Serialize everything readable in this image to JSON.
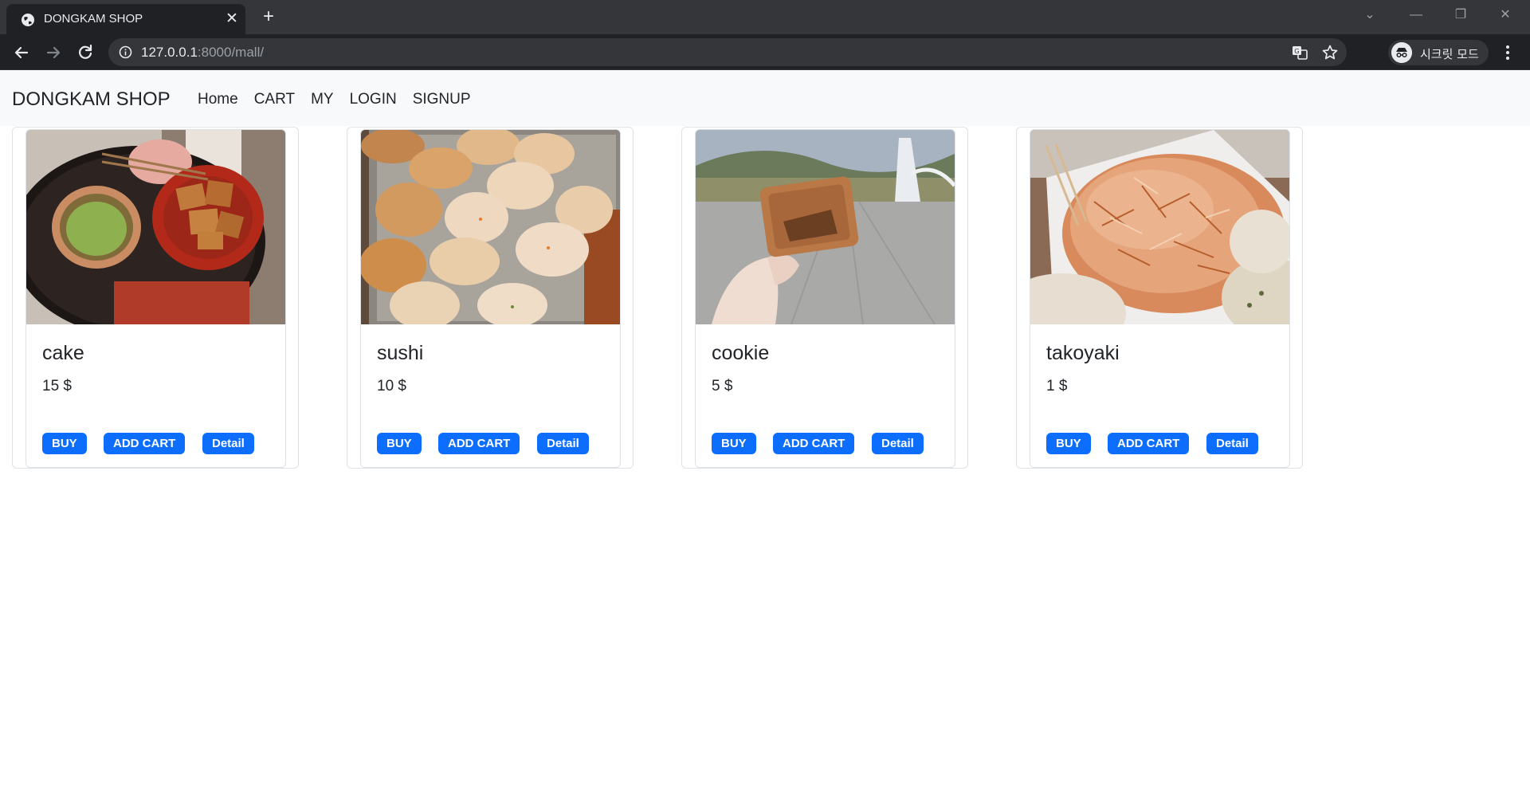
{
  "browser": {
    "tab_title": "DONGKAM SHOP",
    "url_host": "127.0.0.1",
    "url_path": ":8000/mall/",
    "incognito_label": "시크릿 모드"
  },
  "navbar": {
    "brand": "DONGKAM SHOP",
    "links": [
      "Home",
      "CART",
      "MY",
      "LOGIN",
      "SIGNUP"
    ]
  },
  "products": [
    {
      "name": "cake",
      "price": "15 $",
      "image": "matcha-and-warabi-photo"
    },
    {
      "name": "sushi",
      "price": "10 $",
      "image": "inari-sushi-photo"
    },
    {
      "name": "cookie",
      "price": "5 $",
      "image": "cookie-in-hand-park-photo"
    },
    {
      "name": "takoyaki",
      "price": "1 $",
      "image": "takoyaki-bonito-photo"
    }
  ],
  "buttons": {
    "buy": "BUY",
    "add_cart": "ADD CART",
    "detail": "Detail"
  },
  "colors": {
    "primary": "#0d6efd",
    "navbar_bg": "#f8f9fa",
    "chrome_dark": "#202124"
  }
}
